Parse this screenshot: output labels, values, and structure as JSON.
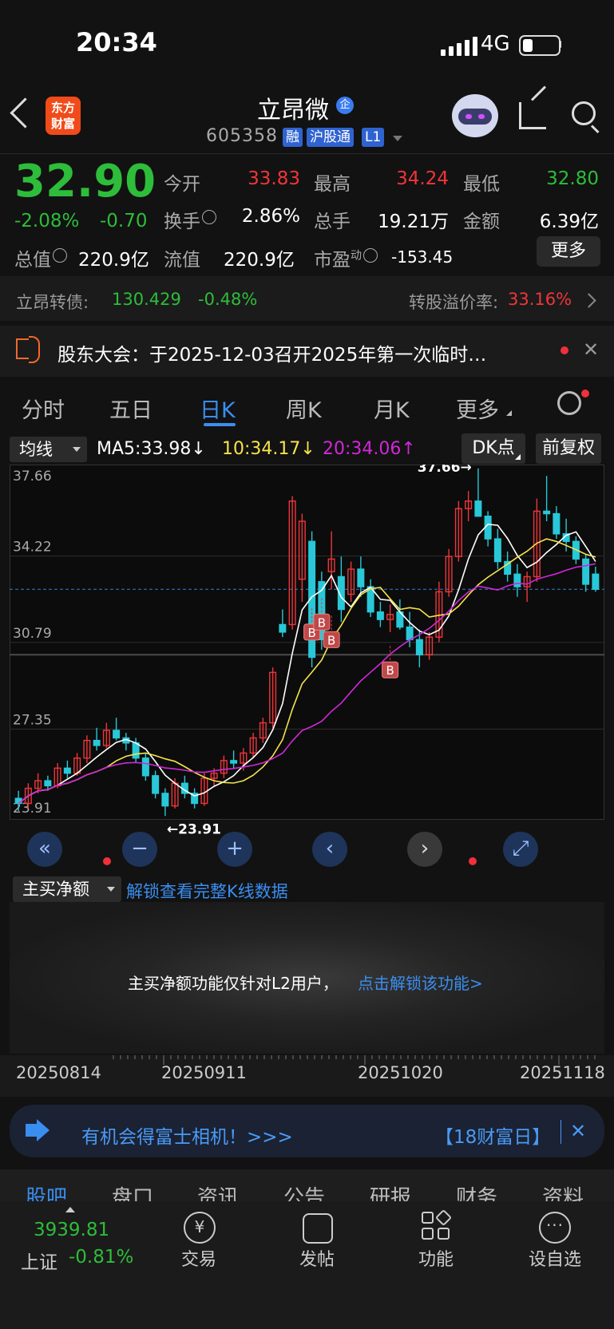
{
  "status_bar": {
    "time": "20:34",
    "network": "4G"
  },
  "header": {
    "logo_line1": "东方",
    "logo_line2": "财富",
    "title": "立昂微",
    "title_badge": "企",
    "code": "605358",
    "tags": [
      "融",
      "沪股通",
      "L1"
    ]
  },
  "quote": {
    "price": "32.90",
    "change_pct": "-2.08%",
    "change": "-0.70",
    "open_label": "今开",
    "open": "33.83",
    "high_label": "最高",
    "high": "34.24",
    "low_label": "最低",
    "low": "32.80",
    "turnover_label": "换手",
    "turnover": "2.86%",
    "volume_label": "总手",
    "volume": "19.21万",
    "amount_label": "金额",
    "amount": "6.39亿",
    "mktcap_label": "总值",
    "mktcap": "220.9亿",
    "float_label": "流值",
    "float_cap": "220.9亿",
    "pe_label": "市盈",
    "pe_sup": "动",
    "pe": "-153.45",
    "more_label": "更多"
  },
  "convertible": {
    "name": "立昂转债:",
    "price": "130.429",
    "change": "-0.48%",
    "premium_label": "转股溢价率:",
    "premium": "33.16%"
  },
  "notice": {
    "text": "股东大会：于2025-12-03召开2025年第一次临时…"
  },
  "tabs": [
    "分时",
    "五日",
    "日K",
    "周K",
    "月K",
    "更多"
  ],
  "active_tab": "日K",
  "chart_header": {
    "indicator": "均线",
    "ma5": "MA5:33.98↓",
    "ma10": "10:34.17↓",
    "ma20": "20:34.06↑",
    "dk_label": "DK点",
    "adjust_label": "前复权"
  },
  "chart_data": {
    "type": "candlestick",
    "y_ticks": [
      "37.66",
      "34.22",
      "30.79",
      "27.35",
      "23.91"
    ],
    "ylim": [
      23.91,
      37.66
    ],
    "max_label": "37.66→",
    "min_label": "←23.91",
    "current_price": 32.9,
    "buy_marker": "B",
    "x_labels": [
      "20250814",
      "20250911",
      "20251020",
      "20251118"
    ],
    "candles": [
      [
        24.6,
        24.9,
        24.1,
        24.4
      ],
      [
        24.4,
        25.2,
        24.2,
        25.0
      ],
      [
        25.0,
        25.6,
        24.8,
        25.3
      ],
      [
        25.3,
        25.5,
        24.9,
        25.1
      ],
      [
        25.1,
        26.0,
        25.0,
        25.8
      ],
      [
        25.8,
        26.1,
        25.4,
        25.6
      ],
      [
        25.6,
        26.4,
        25.5,
        26.2
      ],
      [
        26.2,
        27.1,
        26.0,
        26.9
      ],
      [
        26.9,
        27.4,
        26.5,
        26.7
      ],
      [
        26.7,
        27.6,
        26.6,
        27.3
      ],
      [
        27.3,
        27.8,
        26.9,
        27.0
      ],
      [
        27.0,
        27.2,
        26.5,
        26.8
      ],
      [
        26.8,
        27.0,
        26.0,
        26.2
      ],
      [
        26.2,
        26.4,
        25.3,
        25.5
      ],
      [
        25.5,
        25.7,
        24.6,
        24.8
      ],
      [
        24.8,
        25.0,
        23.9,
        24.3
      ],
      [
        24.3,
        25.4,
        24.2,
        25.2
      ],
      [
        25.2,
        25.5,
        24.6,
        24.8
      ],
      [
        24.8,
        25.0,
        24.2,
        24.4
      ],
      [
        24.4,
        25.6,
        24.3,
        25.4
      ],
      [
        25.4,
        25.8,
        25.1,
        25.6
      ],
      [
        25.6,
        26.3,
        25.4,
        26.1
      ],
      [
        26.1,
        26.5,
        25.8,
        26.0
      ],
      [
        26.0,
        26.6,
        25.7,
        26.4
      ],
      [
        26.4,
        27.2,
        26.2,
        27.0
      ],
      [
        27.0,
        27.8,
        26.8,
        27.6
      ],
      [
        27.6,
        29.8,
        27.4,
        29.6
      ],
      [
        31.5,
        32.1,
        31.0,
        31.2
      ],
      [
        31.5,
        36.6,
        31.3,
        36.4
      ],
      [
        33.3,
        35.9,
        32.4,
        35.6
      ],
      [
        34.8,
        35.2,
        29.8,
        30.2
      ],
      [
        33.2,
        33.6,
        30.5,
        30.9
      ],
      [
        33.6,
        35.2,
        32.9,
        34.1
      ],
      [
        33.4,
        34.2,
        31.6,
        32.1
      ],
      [
        32.7,
        34.0,
        32.4,
        33.7
      ],
      [
        33.7,
        34.2,
        32.6,
        33.0
      ],
      [
        33.0,
        33.3,
        31.8,
        32.0
      ],
      [
        32.0,
        32.4,
        31.4,
        31.7
      ],
      [
        31.7,
        32.3,
        31.2,
        31.9
      ],
      [
        32.0,
        32.5,
        31.3,
        31.4
      ],
      [
        31.4,
        32.0,
        30.6,
        30.9
      ],
      [
        30.9,
        31.3,
        29.8,
        30.3
      ],
      [
        30.3,
        31.2,
        30.1,
        31.0
      ],
      [
        31.0,
        33.2,
        30.8,
        32.8
      ],
      [
        32.8,
        34.5,
        32.6,
        34.2
      ],
      [
        34.2,
        36.4,
        34.0,
        36.1
      ],
      [
        36.1,
        36.8,
        35.6,
        36.4
      ],
      [
        36.4,
        37.7,
        35.9,
        35.8
      ],
      [
        35.8,
        36.0,
        34.6,
        34.9
      ],
      [
        34.9,
        35.3,
        33.7,
        34.0
      ],
      [
        34.0,
        34.4,
        33.2,
        33.5
      ],
      [
        33.5,
        33.9,
        32.6,
        33.0
      ],
      [
        33.0,
        33.6,
        32.4,
        33.4
      ],
      [
        33.4,
        36.5,
        33.2,
        36.0
      ],
      [
        36.0,
        37.4,
        35.6,
        35.9
      ],
      [
        35.9,
        36.2,
        34.9,
        35.1
      ],
      [
        35.1,
        35.7,
        34.4,
        34.8
      ],
      [
        34.8,
        35.0,
        33.9,
        34.1
      ],
      [
        34.1,
        34.3,
        32.8,
        33.1
      ],
      [
        33.5,
        33.8,
        32.8,
        32.9
      ]
    ],
    "ma_legend": [
      "MA5",
      "10",
      "20"
    ]
  },
  "chart_nav": {
    "first": "«",
    "zoom_out": "−",
    "zoom_in": "+",
    "prev": "‹",
    "next": "›",
    "fullscreen": "⤢"
  },
  "lower_panel": {
    "indicator": "主买净额",
    "unlock_link": "解锁查看完整K线数据",
    "message": "主买净额功能仅针对L2用户，",
    "message_link": "点击解锁该功能>"
  },
  "banner": {
    "text": "有机会得富士相机！>>>",
    "tag": "【18财富日】"
  },
  "subtabs": [
    "股吧",
    "盘口",
    "资讯",
    "公告",
    "研报",
    "财务",
    "资料"
  ],
  "bottom_nav": {
    "index_value": "3939.81",
    "index_name": "上证",
    "index_change": "-0.81%",
    "items": [
      "交易",
      "发帖",
      "功能",
      "设自选"
    ]
  },
  "colors": {
    "up": "#f0353a",
    "down": "#28c8d8",
    "ma5": "#ffffff",
    "ma10": "#f5e44a",
    "ma20": "#d028d8",
    "accent": "#3a8ef0",
    "green": "#2dbd3a"
  }
}
